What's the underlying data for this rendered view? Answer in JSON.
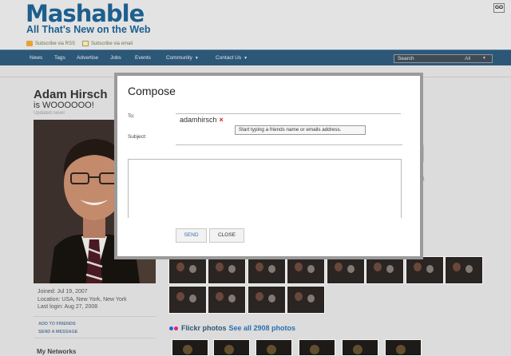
{
  "site": {
    "logo": "Mashable",
    "tagline": "All That's New on the Web",
    "subscribe_rss": "Subscribe via RSS",
    "subscribe_email": "Subscribe via email"
  },
  "nav": {
    "items": [
      "News",
      "Tags",
      "Advertise",
      "Jobs",
      "Events",
      "Community",
      "Contact Us"
    ],
    "search_placeholder": "Search",
    "search_scope": "All",
    "go_label": "GO"
  },
  "profile": {
    "name": "Adam Hirsch",
    "status": "is WOOOOOO!",
    "updated": "Updated never",
    "joined": "Joined: Jul 19, 2007",
    "location": "Location: USA, New York, New York",
    "last_login": "Last login: Aug 27, 2008",
    "add_to_friends": "ADD TO FRIENDS",
    "send_message": "SEND A MESSAGE",
    "my_networks": "My Networks"
  },
  "flickr": {
    "title": "Flickr photos",
    "see_all": "See all 2908 photos"
  },
  "compose": {
    "title": "Compose",
    "to_label": "To:",
    "recipient": "adamhirsch",
    "remove_symbol": "×",
    "hint": "Start typing a friends name or emails address.",
    "subject_label": "Subject:",
    "subject_value": "",
    "message_value": "",
    "send_label": "SEND",
    "close_label": "CLOSE"
  },
  "colors": {
    "brand": "#1d5f8e",
    "nav_bg": "#2d5777",
    "link": "#2b6fb2",
    "remove_red": "#d21c1c"
  }
}
